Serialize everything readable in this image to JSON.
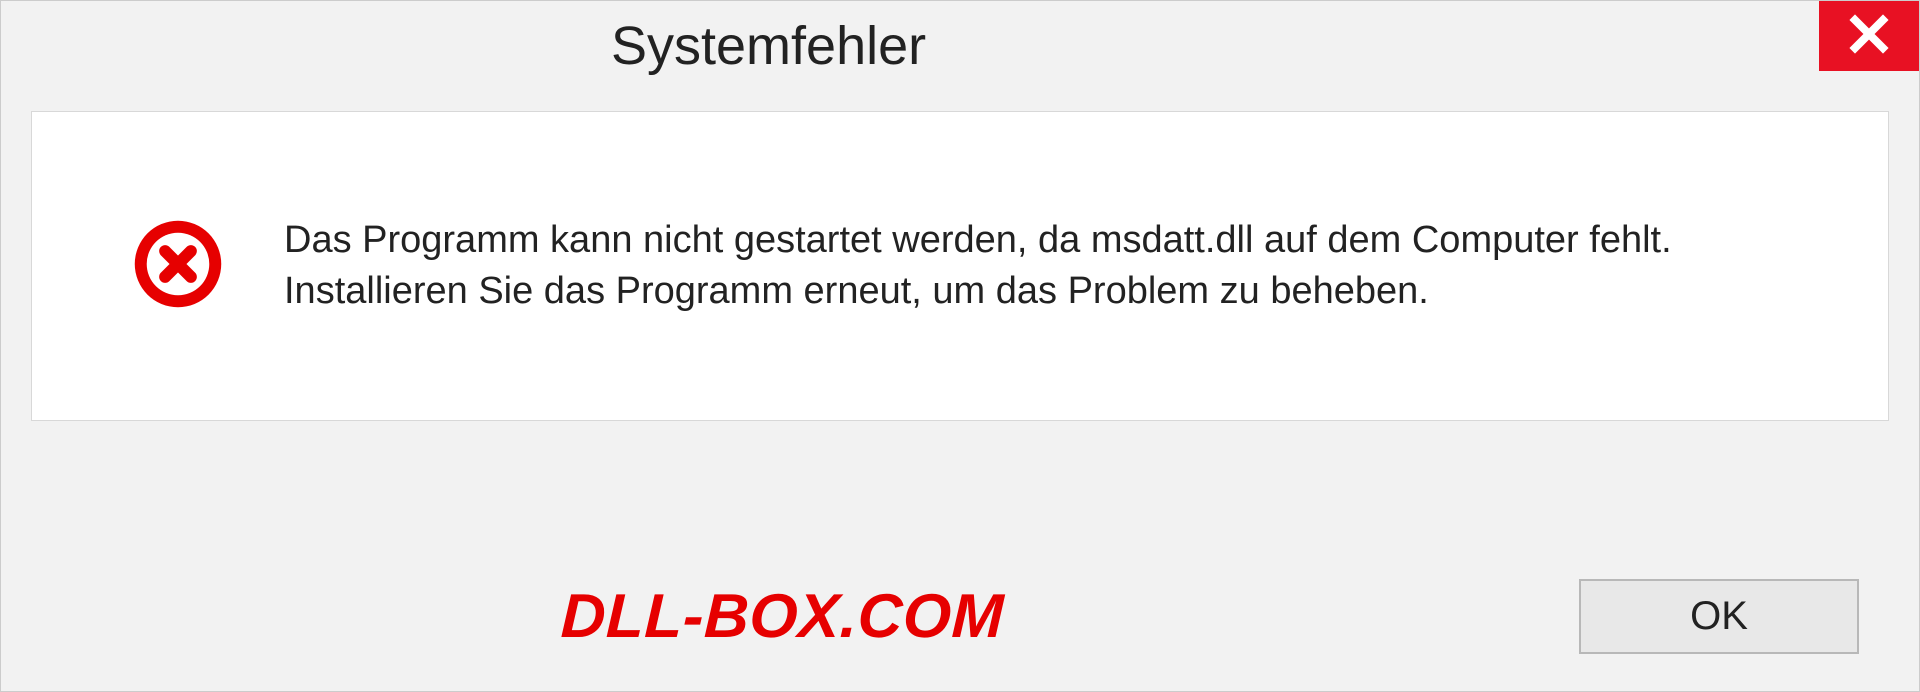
{
  "dialog": {
    "title": "Systemfehler",
    "message": "Das Programm kann nicht gestartet werden, da msdatt.dll auf dem Computer fehlt. Installieren Sie das Programm erneut, um das Problem zu beheben.",
    "ok_label": "OK"
  },
  "watermark": "DLL-BOX.COM"
}
